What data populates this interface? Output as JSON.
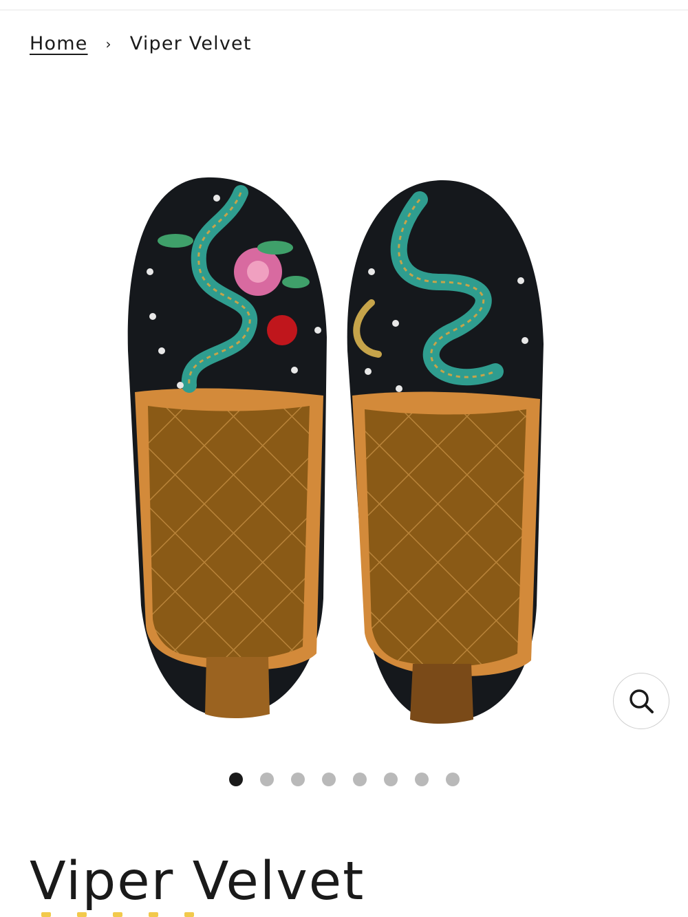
{
  "breadcrumb": {
    "home_label": "Home",
    "separator": "›",
    "current_label": "Viper Velvet"
  },
  "gallery": {
    "image_alt": "Viper Velvet slippers",
    "slide_count": 8,
    "active_slide": 1
  },
  "product": {
    "title": "Viper Velvet",
    "rating_stars": 5
  },
  "colors": {
    "text": "#1a1a1a",
    "dot_inactive": "#b9b9b9",
    "star": "#f2c94c"
  },
  "icons": {
    "zoom": "search-icon"
  }
}
